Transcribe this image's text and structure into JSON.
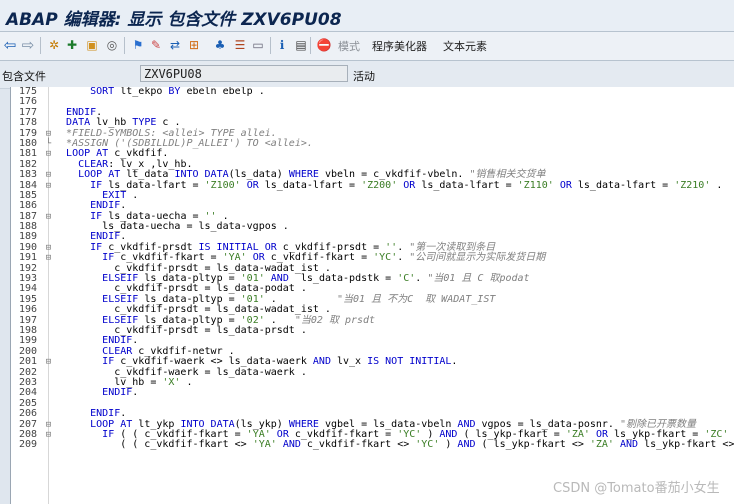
{
  "window": {
    "title": "ABAP 编辑器: 显示 包含文件 ZXV6PU08"
  },
  "toolbar": {
    "icons": [
      "back-icon",
      "forward-icon",
      "settings-icon",
      "activate-icon",
      "other-object-icon",
      "display-change-icon",
      "check-icon",
      "where-used-icon",
      "navigate-icon",
      "hierarchy-icon",
      "layout-icon",
      "window-icon",
      "info-icon",
      "pattern-icon",
      "delete-icon"
    ],
    "mode_label": "模式",
    "pretty_printer_label": "程序美化器",
    "text_elements_label": "文本元素"
  },
  "include_field": {
    "label": "包含文件",
    "value": "ZXV6PU08",
    "status": "活动"
  },
  "watermark": "CSDN @Tomato番茄小女生",
  "colors": {
    "keyword": "#0000cc",
    "string": "#3a7d24",
    "comment": "#808080"
  },
  "code_lines": [
    {
      "n": "175",
      "fold": "",
      "segs": [
        {
          "t": "      "
        },
        {
          "t": "SORT",
          "c": "kw"
        },
        {
          "t": " lt_ekpo "
        },
        {
          "t": "BY",
          "c": "kw"
        },
        {
          "t": " ebeln ebelp ."
        }
      ]
    },
    {
      "n": "176",
      "fold": "",
      "segs": [
        {
          "t": ""
        }
      ]
    },
    {
      "n": "177",
      "fold": "",
      "segs": [
        {
          "t": "  "
        },
        {
          "t": "ENDIF",
          "c": "kw"
        },
        {
          "t": "."
        }
      ]
    },
    {
      "n": "178",
      "fold": "",
      "segs": [
        {
          "t": "  "
        },
        {
          "t": "DATA",
          "c": "kw"
        },
        {
          "t": " lv_hb "
        },
        {
          "t": "TYPE",
          "c": "kw"
        },
        {
          "t": " c ."
        }
      ]
    },
    {
      "n": "179",
      "fold": "⊟",
      "segs": [
        {
          "t": "  "
        },
        {
          "t": "*FIELD-SYMBOLS: <allei> TYPE allei.",
          "c": "cmt"
        }
      ]
    },
    {
      "n": "180",
      "fold": "└",
      "segs": [
        {
          "t": "  "
        },
        {
          "t": "*ASSIGN ('(SDBILLDL)P_ALLEI') TO <allei>.",
          "c": "cmt"
        }
      ]
    },
    {
      "n": "181",
      "fold": "⊟",
      "segs": [
        {
          "t": "  "
        },
        {
          "t": "LOOP AT",
          "c": "kw"
        },
        {
          "t": " c_vkdfif."
        }
      ]
    },
    {
      "n": "182",
      "fold": "",
      "segs": [
        {
          "t": "    "
        },
        {
          "t": "CLEAR",
          "c": "kw"
        },
        {
          "t": ": lv_x ,lv_hb."
        }
      ]
    },
    {
      "n": "183",
      "fold": "⊟",
      "segs": [
        {
          "t": "    "
        },
        {
          "t": "LOOP AT",
          "c": "kw"
        },
        {
          "t": " lt_data "
        },
        {
          "t": "INTO DATA",
          "c": "kw"
        },
        {
          "t": "(ls_data) "
        },
        {
          "t": "WHERE",
          "c": "kw"
        },
        {
          "t": " vbeln = c_vkdfif-vbeln. "
        },
        {
          "t": "\"销售相关交货单",
          "c": "cmt"
        }
      ]
    },
    {
      "n": "184",
      "fold": "⊟",
      "segs": [
        {
          "t": "      "
        },
        {
          "t": "IF",
          "c": "kw"
        },
        {
          "t": " ls_data-lfart = "
        },
        {
          "t": "'Z100'",
          "c": "str"
        },
        {
          "t": " "
        },
        {
          "t": "OR",
          "c": "kw"
        },
        {
          "t": " ls_data-lfart = "
        },
        {
          "t": "'Z200'",
          "c": "str"
        },
        {
          "t": " "
        },
        {
          "t": "OR",
          "c": "kw"
        },
        {
          "t": " ls_data-lfart = "
        },
        {
          "t": "'Z110'",
          "c": "str"
        },
        {
          "t": " "
        },
        {
          "t": "OR",
          "c": "kw"
        },
        {
          "t": " ls_data-lfart = "
        },
        {
          "t": "'Z210'",
          "c": "str"
        },
        {
          "t": " .  "
        },
        {
          "t": "\"",
          "c": "cmt"
        }
      ]
    },
    {
      "n": "185",
      "fold": "",
      "segs": [
        {
          "t": "        "
        },
        {
          "t": "EXIT",
          "c": "kw"
        },
        {
          "t": " ."
        }
      ]
    },
    {
      "n": "186",
      "fold": "",
      "segs": [
        {
          "t": "      "
        },
        {
          "t": "ENDIF",
          "c": "kw"
        },
        {
          "t": "."
        }
      ]
    },
    {
      "n": "187",
      "fold": "⊟",
      "segs": [
        {
          "t": "      "
        },
        {
          "t": "IF",
          "c": "kw"
        },
        {
          "t": " ls_data-uecha = "
        },
        {
          "t": "''",
          "c": "str"
        },
        {
          "t": " ."
        }
      ]
    },
    {
      "n": "188",
      "fold": "",
      "segs": [
        {
          "t": "        ls_data-uecha = ls_data-vgpos ."
        }
      ]
    },
    {
      "n": "189",
      "fold": "",
      "segs": [
        {
          "t": "      "
        },
        {
          "t": "ENDIF",
          "c": "kw"
        },
        {
          "t": "."
        }
      ]
    },
    {
      "n": "190",
      "fold": "⊟",
      "segs": [
        {
          "t": "      "
        },
        {
          "t": "IF",
          "c": "kw"
        },
        {
          "t": " c_vkdfif-prsdt "
        },
        {
          "t": "IS INITIAL OR",
          "c": "kw"
        },
        {
          "t": " c_vkdfif-prsdt = "
        },
        {
          "t": "''",
          "c": "str"
        },
        {
          "t": ". "
        },
        {
          "t": "\"第一次读取到条目",
          "c": "cmt"
        }
      ]
    },
    {
      "n": "191",
      "fold": "⊟",
      "segs": [
        {
          "t": "        "
        },
        {
          "t": "IF",
          "c": "kw"
        },
        {
          "t": " c_vkdfif-fkart = "
        },
        {
          "t": "'YA'",
          "c": "str"
        },
        {
          "t": " "
        },
        {
          "t": "OR",
          "c": "kw"
        },
        {
          "t": " c_vkdfif-fkart = "
        },
        {
          "t": "'YC'",
          "c": "str"
        },
        {
          "t": ". "
        },
        {
          "t": "\"公司间就显示为实际发货日期",
          "c": "cmt"
        }
      ]
    },
    {
      "n": "192",
      "fold": "",
      "segs": [
        {
          "t": "          c_vkdfif-prsdt = ls_data-wadat_ist ."
        }
      ]
    },
    {
      "n": "193",
      "fold": "",
      "segs": [
        {
          "t": "        "
        },
        {
          "t": "ELSEIF",
          "c": "kw"
        },
        {
          "t": " ls_data-pltyp = "
        },
        {
          "t": "'01'",
          "c": "str"
        },
        {
          "t": " "
        },
        {
          "t": "AND",
          "c": "kw"
        },
        {
          "t": "  ls_data-pdstk = "
        },
        {
          "t": "'C'",
          "c": "str"
        },
        {
          "t": ". "
        },
        {
          "t": "\"当01 且 C 取podat",
          "c": "cmt"
        }
      ]
    },
    {
      "n": "194",
      "fold": "",
      "segs": [
        {
          "t": "          c_vkdfif-prsdt = ls_data-podat ."
        }
      ]
    },
    {
      "n": "195",
      "fold": "",
      "segs": [
        {
          "t": "        "
        },
        {
          "t": "ELSEIF",
          "c": "kw"
        },
        {
          "t": " ls_data-pltyp = "
        },
        {
          "t": "'01'",
          "c": "str"
        },
        {
          "t": " .          "
        },
        {
          "t": "\"当01 且 不为C  取 WADAT_IST",
          "c": "cmt"
        }
      ]
    },
    {
      "n": "196",
      "fold": "",
      "segs": [
        {
          "t": "          c_vkdfif-prsdt = ls_data-wadat_ist ."
        }
      ]
    },
    {
      "n": "197",
      "fold": "",
      "segs": [
        {
          "t": "        "
        },
        {
          "t": "ELSEIF",
          "c": "kw"
        },
        {
          "t": " ls_data-pltyp = "
        },
        {
          "t": "'02'",
          "c": "str"
        },
        {
          "t": " .   "
        },
        {
          "t": "\"当02 取 prsdt",
          "c": "cmt"
        }
      ]
    },
    {
      "n": "198",
      "fold": "",
      "segs": [
        {
          "t": "          c_vkdfif-prsdt = ls_data-prsdt ."
        }
      ]
    },
    {
      "n": "199",
      "fold": "",
      "segs": [
        {
          "t": "        "
        },
        {
          "t": "ENDIF",
          "c": "kw"
        },
        {
          "t": "."
        }
      ]
    },
    {
      "n": "200",
      "fold": "",
      "segs": [
        {
          "t": "        "
        },
        {
          "t": "CLEAR",
          "c": "kw"
        },
        {
          "t": " c_vkdfif-netwr ."
        }
      ]
    },
    {
      "n": "201",
      "fold": "⊟",
      "segs": [
        {
          "t": "        "
        },
        {
          "t": "IF",
          "c": "kw"
        },
        {
          "t": " c_vkdfif-waerk <> ls_data-waerk "
        },
        {
          "t": "AND",
          "c": "kw"
        },
        {
          "t": " lv_x "
        },
        {
          "t": "IS NOT INITIAL",
          "c": "kw"
        },
        {
          "t": "."
        }
      ]
    },
    {
      "n": "202",
      "fold": "",
      "segs": [
        {
          "t": "          c_vkdfif-waerk = ls_data-waerk ."
        }
      ]
    },
    {
      "n": "203",
      "fold": "",
      "segs": [
        {
          "t": "          lv_hb = "
        },
        {
          "t": "'X'",
          "c": "str"
        },
        {
          "t": " ."
        }
      ]
    },
    {
      "n": "204",
      "fold": "",
      "segs": [
        {
          "t": "        "
        },
        {
          "t": "ENDIF",
          "c": "kw"
        },
        {
          "t": "."
        }
      ]
    },
    {
      "n": "205",
      "fold": "",
      "segs": [
        {
          "t": ""
        }
      ]
    },
    {
      "n": "206",
      "fold": "",
      "segs": [
        {
          "t": "      "
        },
        {
          "t": "ENDIF",
          "c": "kw"
        },
        {
          "t": "."
        }
      ]
    },
    {
      "n": "207",
      "fold": "⊟",
      "segs": [
        {
          "t": "      "
        },
        {
          "t": "LOOP AT",
          "c": "kw"
        },
        {
          "t": " lt_ykp "
        },
        {
          "t": "INTO DATA",
          "c": "kw"
        },
        {
          "t": "(ls_ykp) "
        },
        {
          "t": "WHERE",
          "c": "kw"
        },
        {
          "t": " vgbel = ls_data-vbeln "
        },
        {
          "t": "AND",
          "c": "kw"
        },
        {
          "t": " vgpos = ls_data-posnr. "
        },
        {
          "t": "\"剔除已开票数量",
          "c": "cmt"
        }
      ]
    },
    {
      "n": "208",
      "fold": "⊟",
      "segs": [
        {
          "t": "        "
        },
        {
          "t": "IF",
          "c": "kw"
        },
        {
          "t": " ( ( c_vkdfif-fkart = "
        },
        {
          "t": "'YA'",
          "c": "str"
        },
        {
          "t": " "
        },
        {
          "t": "OR",
          "c": "kw"
        },
        {
          "t": " c_vkdfif-fkart = "
        },
        {
          "t": "'YC'",
          "c": "str"
        },
        {
          "t": " ) "
        },
        {
          "t": "AND",
          "c": "kw"
        },
        {
          "t": " ( ls_ykp-fkart = "
        },
        {
          "t": "'ZA'",
          "c": "str"
        },
        {
          "t": " "
        },
        {
          "t": "OR",
          "c": "kw"
        },
        {
          "t": " ls_ykp-fkart = "
        },
        {
          "t": "'ZC'",
          "c": "str"
        }
      ]
    },
    {
      "n": "209",
      "fold": "",
      "segs": [
        {
          "t": "           ( ( c_vkdfif-fkart <> "
        },
        {
          "t": "'YA'",
          "c": "str"
        },
        {
          "t": " "
        },
        {
          "t": "AND",
          "c": "kw"
        },
        {
          "t": " c_vkdfif-fkart <> "
        },
        {
          "t": "'YC'",
          "c": "str"
        },
        {
          "t": " ) "
        },
        {
          "t": "AND",
          "c": "kw"
        },
        {
          "t": " ( ls_ykp-fkart <> "
        },
        {
          "t": "'ZA'",
          "c": "str"
        },
        {
          "t": " "
        },
        {
          "t": "AND",
          "c": "kw"
        },
        {
          "t": " ls_ykp-fkart <> "
        }
      ]
    }
  ]
}
